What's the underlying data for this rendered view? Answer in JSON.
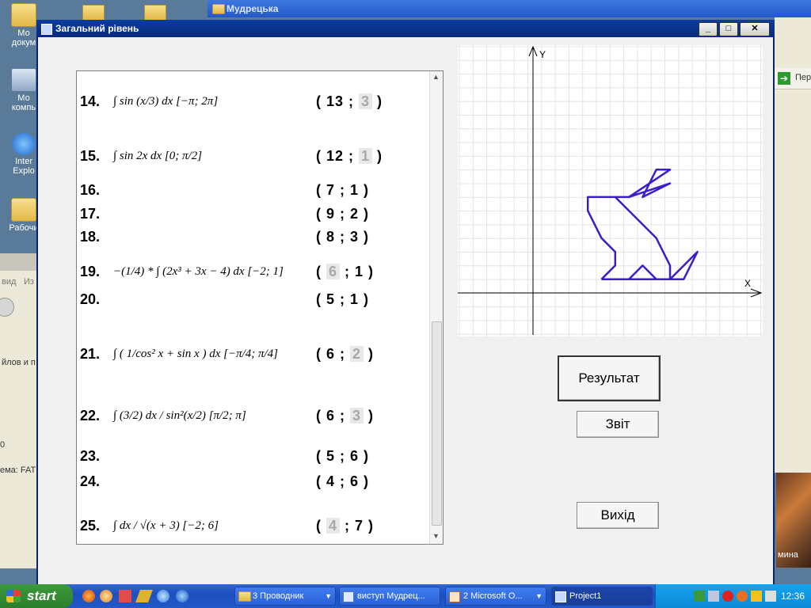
{
  "desktop": {
    "icons": [
      {
        "label": "Мо докум",
        "icon": "my-documents-icon"
      },
      {
        "label": "Мо компь",
        "icon": "my-computer-icon"
      },
      {
        "label": "Inter Explo",
        "icon": "internet-explorer-icon"
      },
      {
        "label": "Рабочи",
        "icon": "desktop-folder-icon"
      }
    ],
    "background_window_title": "Мудрецька",
    "left_window_fragments": [
      "вид",
      "Из",
      "йлов и п",
      "0",
      "ема: FAT"
    ],
    "right_window_fragment": "Пер",
    "right_image_caption": "мина"
  },
  "window": {
    "title": "Загальний рівень",
    "minimize": "_",
    "maximize": "□",
    "close": "✕"
  },
  "rows": [
    {
      "n": "14.",
      "expr": "∫ sin (x/3) dx  [−π; 2π]",
      "a": "13",
      "b": "3",
      "hl": "b"
    },
    {
      "n": "15.",
      "expr": "∫ sin 2x dx  [0; π/2]",
      "a": "12",
      "b": "1",
      "hl": "b"
    },
    {
      "n": "16.",
      "expr": "",
      "a": "7",
      "b": "1",
      "hl": ""
    },
    {
      "n": "17.",
      "expr": "",
      "a": "9",
      "b": "2",
      "hl": ""
    },
    {
      "n": "18.",
      "expr": "",
      "a": "8",
      "b": "3",
      "hl": ""
    },
    {
      "n": "19.",
      "expr": "−(1/4) * ∫ (2x³ + 3x − 4) dx  [−2; 1]",
      "a": "6",
      "b": "1",
      "hl": "a"
    },
    {
      "n": "20.",
      "expr": "",
      "a": "5",
      "b": "1",
      "hl": ""
    },
    {
      "n": "21.",
      "expr": "∫ ( 1/cos² x + sin x ) dx  [−π/4; π/4]",
      "a": "6",
      "b": "2",
      "hl": "b"
    },
    {
      "n": "22.",
      "expr": "∫ (3/2) dx / sin²(x/2)  [π/2; π]",
      "a": "6",
      "b": "3",
      "hl": "b"
    },
    {
      "n": "23.",
      "expr": "",
      "a": "5",
      "b": "6",
      "hl": ""
    },
    {
      "n": "24.",
      "expr": "",
      "a": "4",
      "b": "6",
      "hl": ""
    },
    {
      "n": "25.",
      "expr": "∫ dx / √(x + 3)  [−2; 6]",
      "a": "4",
      "b": "7",
      "hl": "a"
    }
  ],
  "plot": {
    "x_axis_label": "X",
    "y_axis_label": "Y",
    "figure_color": "#3a1fc8",
    "points": [
      [
        5,
        1
      ],
      [
        6,
        2
      ],
      [
        6,
        3
      ],
      [
        5,
        4
      ],
      [
        4,
        6
      ],
      [
        4,
        7
      ],
      [
        6,
        7
      ],
      [
        9,
        4
      ],
      [
        10,
        2
      ],
      [
        10,
        1
      ],
      [
        12,
        3
      ],
      [
        11,
        1
      ],
      [
        7,
        1
      ],
      [
        8,
        2
      ],
      [
        9,
        1
      ],
      [
        5,
        1
      ]
    ],
    "ear": [
      [
        6,
        7
      ],
      [
        7,
        7
      ],
      [
        10,
        8
      ],
      [
        8,
        7
      ],
      [
        9,
        9
      ],
      [
        10,
        9
      ],
      [
        7,
        7
      ]
    ]
  },
  "buttons": {
    "result": "Результат",
    "report": "Звіт",
    "exit": "Вихід"
  },
  "taskbar": {
    "start": "start",
    "tasks": [
      {
        "label": "3 Проводник"
      },
      {
        "label": "виступ Мудрец..."
      },
      {
        "label": "2 Microsoft O..."
      },
      {
        "label": "Project1"
      }
    ],
    "language": "RU",
    "clock": "12:36"
  }
}
